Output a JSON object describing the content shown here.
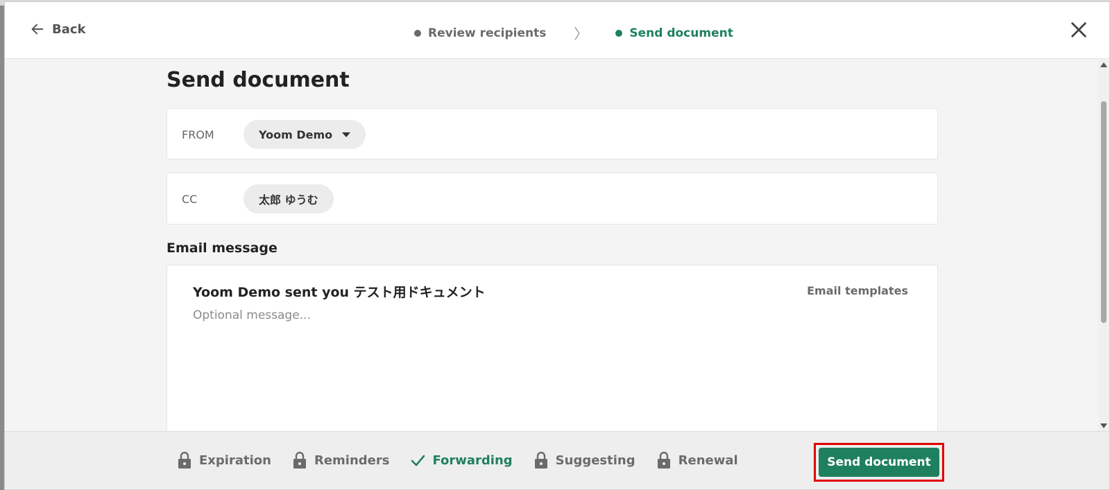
{
  "header": {
    "back_label": "Back",
    "steps": [
      {
        "label": "Review recipients",
        "active": false
      },
      {
        "label": "Send document",
        "active": true
      }
    ]
  },
  "page": {
    "title": "Send document"
  },
  "from": {
    "label": "FROM",
    "value": "Yoom Demo"
  },
  "cc": {
    "label": "CC",
    "value": "太郎 ゆうむ"
  },
  "email": {
    "section_title": "Email message",
    "subject": "Yoom Demo sent you テスト用ドキュメント",
    "templates_label": "Email templates",
    "message_placeholder": "Optional message...",
    "message_value": ""
  },
  "footer": {
    "options": [
      {
        "label": "Expiration",
        "icon": "lock-icon",
        "enabled": false
      },
      {
        "label": "Reminders",
        "icon": "lock-icon",
        "enabled": false
      },
      {
        "label": "Forwarding",
        "icon": "check-icon",
        "enabled": true
      },
      {
        "label": "Suggesting",
        "icon": "lock-icon",
        "enabled": false
      },
      {
        "label": "Renewal",
        "icon": "lock-icon",
        "enabled": false
      }
    ],
    "send_label": "Send document"
  },
  "colors": {
    "accent": "#1f8060",
    "muted_text": "#6b6b6b",
    "highlight_border": "#e00000"
  }
}
